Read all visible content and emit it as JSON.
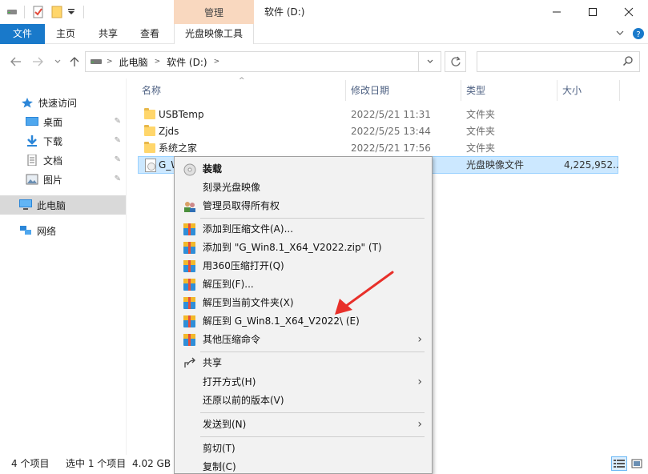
{
  "window": {
    "title": "软件 (D:)",
    "context_tab": "管理",
    "controls": [
      "minimize",
      "maximize",
      "close"
    ]
  },
  "ribbon": {
    "tabs": [
      {
        "label": "文件"
      },
      {
        "label": "主页"
      },
      {
        "label": "共享"
      },
      {
        "label": "查看"
      },
      {
        "label": "光盘映像工具"
      }
    ]
  },
  "address": {
    "breadcrumb": [
      "此电脑",
      "软件 (D:)"
    ],
    "search_placeholder": ""
  },
  "sidebar": {
    "items": [
      {
        "label": "快速访问",
        "icon": "star-icon"
      },
      {
        "label": "桌面",
        "icon": "desktop-icon",
        "pinned": true
      },
      {
        "label": "下载",
        "icon": "download-icon",
        "pinned": true
      },
      {
        "label": "文档",
        "icon": "document-icon",
        "pinned": true
      },
      {
        "label": "图片",
        "icon": "picture-icon",
        "pinned": true
      },
      {
        "label": "此电脑",
        "icon": "computer-icon",
        "selected": true
      },
      {
        "label": "网络",
        "icon": "network-icon"
      }
    ]
  },
  "columns": {
    "name": "名称",
    "date": "修改日期",
    "type": "类型",
    "size": "大小"
  },
  "files": [
    {
      "name": "USBTemp",
      "date": "2022/5/21 11:31",
      "type": "文件夹",
      "size": ""
    },
    {
      "name": "Zjds",
      "date": "2022/5/25 13:44",
      "type": "文件夹",
      "size": ""
    },
    {
      "name": "系统之家",
      "date": "2022/5/21 17:56",
      "type": "文件夹",
      "size": ""
    },
    {
      "name": "G_W",
      "date": "",
      "type": "光盘映像文件",
      "size": "4,225,952..."
    }
  ],
  "context_menu": {
    "items": [
      {
        "label": "装载",
        "icon": "disc-icon",
        "bold": true
      },
      {
        "label": "刻录光盘映像",
        "icon": ""
      },
      {
        "label": "管理员取得所有权",
        "icon": "admin-icon"
      },
      {
        "label": "添加到压缩文件(A)...",
        "icon": "archive-icon"
      },
      {
        "label": "添加到 \"G_Win8.1_X64_V2022.zip\" (T)",
        "icon": "archive-icon"
      },
      {
        "label": "用360压缩打开(Q)",
        "icon": "archive-icon"
      },
      {
        "label": "解压到(F)...",
        "icon": "archive-icon"
      },
      {
        "label": "解压到当前文件夹(X)",
        "icon": "archive-icon"
      },
      {
        "label": "解压到 G_Win8.1_X64_V2022\\ (E)",
        "icon": "archive-icon"
      },
      {
        "label": "其他压缩命令",
        "icon": "archive-icon",
        "submenu": true
      },
      {
        "label": "共享",
        "icon": "share-icon"
      },
      {
        "label": "打开方式(H)",
        "icon": "",
        "submenu": true
      },
      {
        "label": "还原以前的版本(V)",
        "icon": ""
      },
      {
        "label": "发送到(N)",
        "icon": "",
        "submenu": true
      },
      {
        "label": "剪切(T)",
        "icon": ""
      },
      {
        "label": "复制(C)",
        "icon": ""
      }
    ]
  },
  "status": {
    "count": "4 个项目",
    "selected": "选中 1 个项目",
    "size": "4.02 GB"
  },
  "colors": {
    "accent": "#1979ca",
    "context_tab": "#f9d8bf",
    "selection": "#cce8ff",
    "annotation_arrow": "#e8302a"
  }
}
